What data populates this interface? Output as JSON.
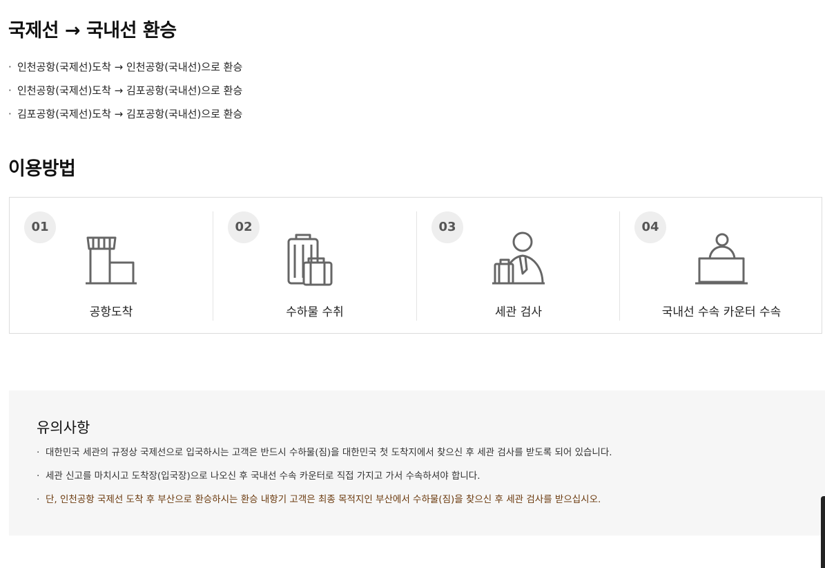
{
  "transfer": {
    "title": "국제선 → 국내선 환승",
    "routes": [
      "인천공항(국제선)도착 → 인천공항(국내선)으로 환승",
      "인천공항(국제선)도착 → 김포공항(국내선)으로 환승",
      "김포공항(국제선)도착 → 김포공항(국내선)으로 환승"
    ]
  },
  "usage": {
    "title": "이용방법",
    "steps": [
      {
        "num": "01",
        "label": "공항도착",
        "icon": "airport-tower-icon"
      },
      {
        "num": "02",
        "label": "수하물 수취",
        "icon": "luggage-icon"
      },
      {
        "num": "03",
        "label": "세관 검사",
        "icon": "customs-officer-icon"
      },
      {
        "num": "04",
        "label": "국내선 수속 카운터 수속",
        "icon": "check-in-counter-icon"
      }
    ]
  },
  "notice": {
    "title": "유의사항",
    "items": [
      "대한민국 세관의 규정상 국제선으로 입국하시는 고객은 반드시 수하물(짐)을 대한민국 첫 도착지에서 찾으신 후 세관 검사를 받도록 되어 있습니다.",
      "세관 신고를 마치시고 도착장(입국장)으로 나오신 후 국내선 수속 카운터로 직접 가지고 가서 수속하셔야 합니다.",
      "단, 인천공항 국제선 도착 후 부산으로 환승하시는 환승 내항기 고객은 최종 목적지인 부산에서 수하물(짐)을 찾으신 후 세관 검사를 받으십시오."
    ],
    "highlight_color": "#6b3a0e"
  },
  "bullet": "·",
  "colors": {
    "icon_stroke": "#666666",
    "step_badge_bg": "#eeeeee",
    "notice_bg": "#f6f6f6"
  }
}
